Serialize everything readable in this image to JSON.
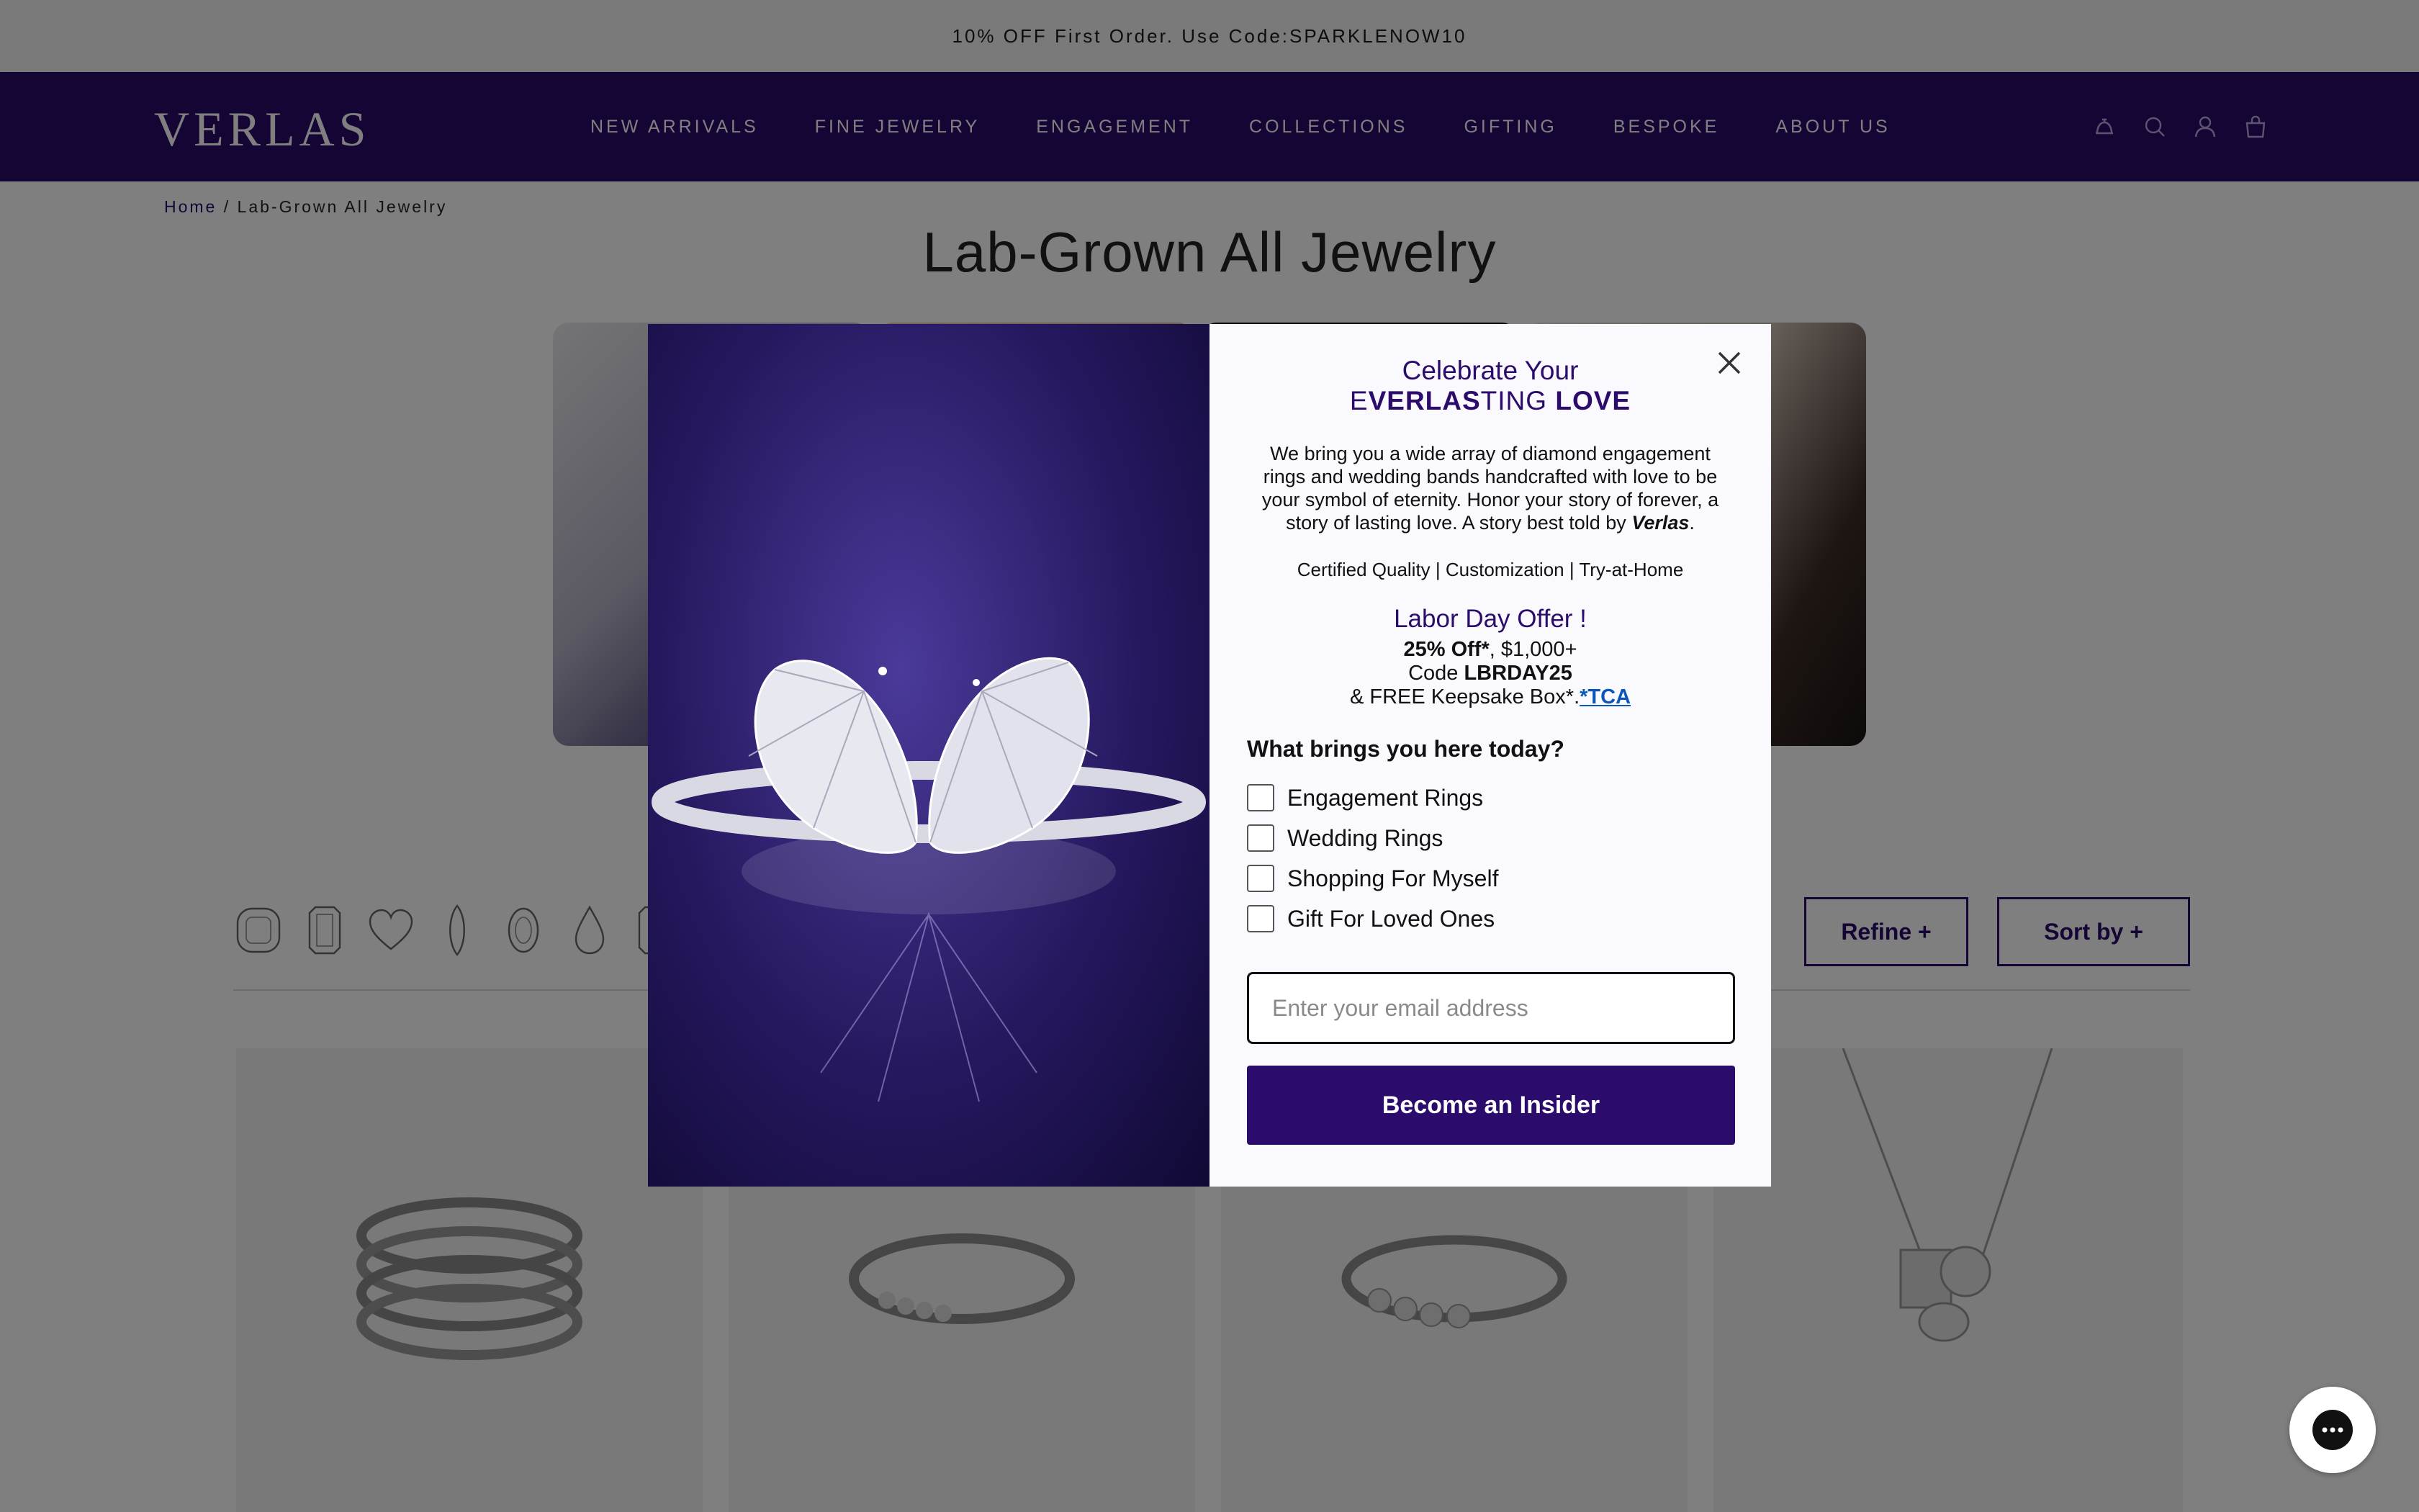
{
  "announcement": {
    "text": "10% OFF First Order. Use Code:SPARKLENOW10"
  },
  "header": {
    "logo": "VERLAS",
    "nav": [
      "NEW ARRIVALS",
      "FINE JEWELRY",
      "ENGAGEMENT",
      "COLLECTIONS",
      "GIFTING",
      "BESPOKE",
      "ABOUT US"
    ],
    "icons": [
      "appointment-bell-icon",
      "search-icon",
      "account-icon",
      "cart-icon"
    ]
  },
  "breadcrumb": {
    "home": "Home",
    "separator": "/",
    "current": "Lab-Grown All Jewelry"
  },
  "page": {
    "title": "Lab-Grown All Jewelry"
  },
  "toolbar": {
    "shapes": [
      "cushion-shape-icon",
      "emerald-shape-icon",
      "heart-shape-icon",
      "marquise-shape-icon",
      "oval-shape-icon",
      "pear-shape-icon",
      "radiant-shape-icon"
    ],
    "refine_label": "Refine +",
    "sort_label": "Sort by +"
  },
  "products": [
    "stacked-ring",
    "open-cuff-ring",
    "toi-et-moi-ring",
    "cluster-pendant-necklace"
  ],
  "modal": {
    "title_line1": "Celebrate Your",
    "title_e": "E",
    "title_verlas": "VERLAS",
    "title_ting": "TING",
    "title_love": "LOVE",
    "description": "We bring you a wide array of diamond engagement rings and wedding bands handcrafted with love to be your symbol of eternity. Honor your story of forever, a story of lasting love. A story best told by",
    "description_brand": "Verlas",
    "description_end": ".",
    "features": "Certified Quality | Customization | Try-at-Home",
    "offer_title": "Labor Day Offer !",
    "offer_discount": "25% Off*",
    "offer_threshold": ", $1,000+",
    "offer_code_label": "Code",
    "offer_code": "LBRDAY25",
    "offer_gift": "& FREE Keepsake Box*.",
    "offer_terms": "*TCA",
    "question": "What brings you here today?",
    "options": [
      "Engagement Rings",
      "Wedding Rings",
      "Shopping For Myself",
      "Gift For Loved Ones"
    ],
    "email_placeholder": "Enter your email address",
    "submit_label": "Become an Insider"
  },
  "colors": {
    "brand": "#2b0b6b",
    "link": "#0b57b8"
  }
}
